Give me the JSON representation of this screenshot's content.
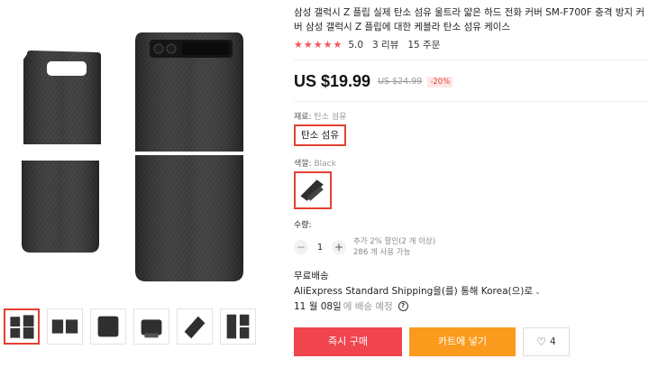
{
  "product": {
    "title": "삼성 갤럭시 Z 플립 실제 탄소 섬유 울트라 얇은 하드 전화 커버 SM-F700F 충격 방지 커버 삼성 갤럭시 Z 플립에 대한 케블라 탄소 섬유 케이스",
    "stars": "★★★★★",
    "rating": "5.0",
    "reviews": "3 리뷰",
    "orders": "15 주문"
  },
  "price": {
    "current": "US $19.99",
    "original": "US $24.99",
    "discount": "-20%"
  },
  "material": {
    "label": "재료:",
    "value": "탄소 섬유",
    "option": "탄소 섬유"
  },
  "color": {
    "label": "색깔:",
    "value": "Black"
  },
  "quantity": {
    "label": "수량:",
    "minus": "−",
    "value": "1",
    "plus": "+",
    "note_line1": "추가 2% 할인(2 개 이상)",
    "note_line2": "286 개 사용 가능"
  },
  "shipping": {
    "title": "무료배송",
    "method": "AliExpress Standard Shipping을(를) 통해 Korea(으)로",
    "chevron": "⌄",
    "date": "11 월 08일",
    "estimate": "에 배송 예정",
    "help": "?"
  },
  "actions": {
    "buy_label": "즉시 구매",
    "cart_label": "카트에 넣기",
    "wish_count": "4",
    "wish_icon": "heart-icon"
  },
  "colors": {
    "accent": "#e63f32",
    "buy": "#f0454f",
    "cart": "#fa9b1d",
    "case": "#2e2e2e"
  }
}
